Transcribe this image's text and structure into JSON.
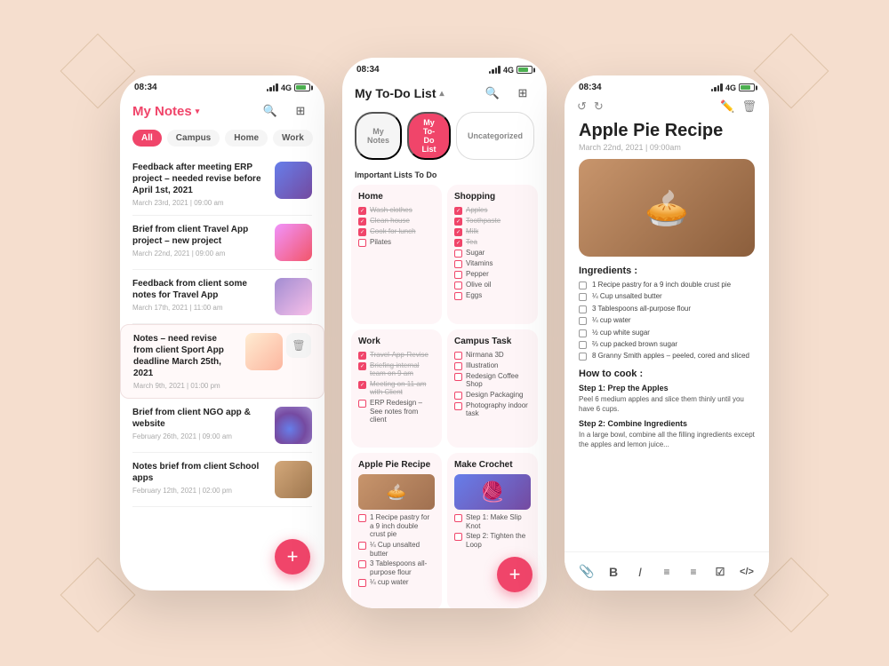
{
  "background": "#f5dece",
  "left_phone": {
    "status_time": "08:34",
    "title": "My Notes",
    "filters": [
      "All",
      "Campus",
      "Home",
      "Work"
    ],
    "active_filter": "All",
    "notes": [
      {
        "id": 1,
        "title": "Feedback after meeting ERP project – needed revise before April 1st, 2021",
        "date": "March 23rd, 2021  |  09:00 am",
        "thumb_type": "blue"
      },
      {
        "id": 2,
        "title": "Brief from client Travel App project – new project",
        "date": "March 22nd, 2021  |  09:00 am",
        "thumb_type": "pink"
      },
      {
        "id": 3,
        "title": "Feedback from client some notes for Travel App",
        "date": "March 17th, 2021  |  11:00 am",
        "thumb_type": "lavender"
      },
      {
        "id": 4,
        "title": "Notes – need revise from client Sport App deadline March 25th, 2021",
        "date": "March 9th, 2021  |  01:00 pm",
        "thumb_type": "pinkwhite",
        "highlighted": true
      },
      {
        "id": 5,
        "title": "Brief from client NGO app & website",
        "date": "February 26th, 2021  |  09:00 am",
        "thumb_type": "orb"
      },
      {
        "id": 6,
        "title": "Notes brief from client School apps",
        "date": "February 12th, 2021  |  02:00 pm",
        "thumb_type": "brown"
      }
    ],
    "fab_label": "+"
  },
  "mid_phone": {
    "status_time": "08:34",
    "title": "My To-Do List",
    "tabs": [
      "My Notes",
      "My To-Do List",
      "Uncategorized"
    ],
    "active_tab": "My To-Do List",
    "important_label": "Important Lists To Do",
    "cards": [
      {
        "id": "home",
        "title": "Home",
        "items": [
          {
            "label": "Wash clothes",
            "checked": true
          },
          {
            "label": "Clean house",
            "checked": true
          },
          {
            "label": "Cook for lunch",
            "checked": true
          },
          {
            "label": "Pilates",
            "checked": false
          }
        ]
      },
      {
        "id": "shopping",
        "title": "Shopping",
        "items": [
          {
            "label": "Apples",
            "checked": true
          },
          {
            "label": "Toothpaste",
            "checked": true
          },
          {
            "label": "Milk",
            "checked": true
          },
          {
            "label": "Tea",
            "checked": true
          },
          {
            "label": "Sugar",
            "checked": false
          },
          {
            "label": "Vitamins",
            "checked": false
          },
          {
            "label": "Pepper",
            "checked": false
          },
          {
            "label": "Olive oil",
            "checked": false
          },
          {
            "label": "Eggs",
            "checked": false
          }
        ]
      },
      {
        "id": "work",
        "title": "Work",
        "items": [
          {
            "label": "Travel-App-Revise",
            "checked": true
          },
          {
            "label": "Briefing internal team on 9 am",
            "checked": true
          },
          {
            "label": "Meeting on 11 am with Client",
            "checked": true
          },
          {
            "label": "ERP Redesign – See notes from client",
            "checked": false
          }
        ]
      },
      {
        "id": "campus",
        "title": "Campus Task",
        "items": [
          {
            "label": "Nirmana 3D",
            "checked": false
          },
          {
            "label": "Illustration",
            "checked": false
          },
          {
            "label": "Redesign Coffee Shop",
            "checked": false
          },
          {
            "label": "Design Packaging",
            "checked": false
          },
          {
            "label": "Photography indoor task",
            "checked": false
          }
        ]
      },
      {
        "id": "recipe",
        "title": "Apple Pie Recipe",
        "has_thumb": true,
        "items": [
          {
            "label": "1 Recipe pastry for a 9 inch double crust pie",
            "checked": false
          },
          {
            "label": "¼ Cup unsalted butter",
            "checked": false
          },
          {
            "label": "3 Tablespoons all-purpose flour",
            "checked": false
          },
          {
            "label": "¼ cup water",
            "checked": false
          }
        ]
      },
      {
        "id": "crochet",
        "title": "Make Crochet",
        "has_thumb": true,
        "items": [
          {
            "label": "Step 1: Make Slip Knot",
            "checked": false
          },
          {
            "label": "Step 2: Tighten the Loop",
            "checked": false
          }
        ]
      }
    ],
    "fab_label": "+"
  },
  "right_phone": {
    "status_time": "08:34",
    "title": "Apple Pie Recipe",
    "date": "March 22nd, 2021  |  09:00am",
    "ingredients_label": "Ingredients :",
    "ingredients": [
      "1 Recipe pastry for a 9 inch double crust pie",
      "¼ Cup unsalted butter",
      "3 Tablespoons all-purpose flour",
      "¼ cup water",
      "½ cup white sugar",
      "⅔ cup packed brown sugar",
      "8 Granny Smith apples – peeled, cored and sliced"
    ],
    "how_to_cook_label": "How to cook :",
    "steps": [
      {
        "title": "Step 1: Prep the Apples",
        "text": "Peel 6 medium apples and slice them thinly until you have 6 cups."
      },
      {
        "title": "Step 2: Combine Ingredients",
        "text": "In a large bowl, combine all the filling ingredients except the apples and lemon juice..."
      }
    ],
    "toolbar_icons": [
      "📎",
      "B",
      "I",
      "≡",
      "≡",
      "≡",
      "</>"
    ]
  }
}
